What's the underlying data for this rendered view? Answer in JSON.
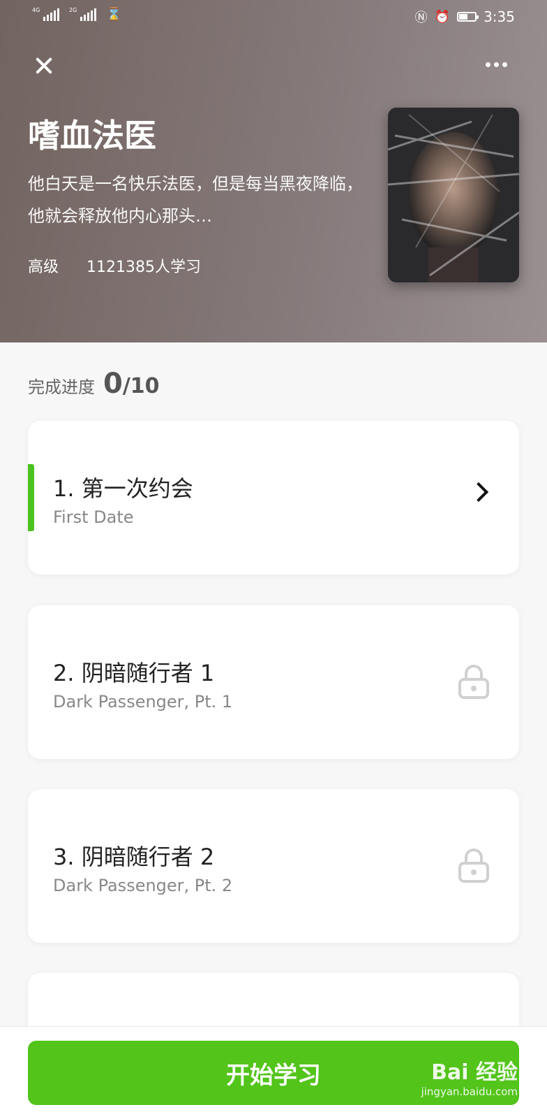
{
  "status_bar": {
    "signal1": "4G",
    "signal2": "2G",
    "time": "3:35",
    "battery_level": 0.55
  },
  "header": {
    "title": "嗜血法医",
    "description": "他白天是一名快乐法医，但是每当黑夜降临，他就会释放他内心那头…",
    "level": "高级",
    "learners": "1121385人学习"
  },
  "progress": {
    "label": "完成进度",
    "done": "0",
    "total": "/10"
  },
  "lessons": [
    {
      "title": "1. 第一次约会",
      "subtitle": "First Date",
      "state": "current"
    },
    {
      "title": "2. 阴暗随行者 1",
      "subtitle": "Dark Passenger, Pt. 1",
      "state": "locked"
    },
    {
      "title": "3. 阴暗随行者 2",
      "subtitle": "Dark Passenger, Pt. 2",
      "state": "locked"
    }
  ],
  "footer": {
    "start_label": "开始学习"
  },
  "watermark": {
    "brand": "Bai 经验",
    "url": "jingyan.baidu.com"
  },
  "colors": {
    "accent": "#52c41a",
    "header_bg": "#7d716f",
    "lock": "#d0d0d0"
  }
}
